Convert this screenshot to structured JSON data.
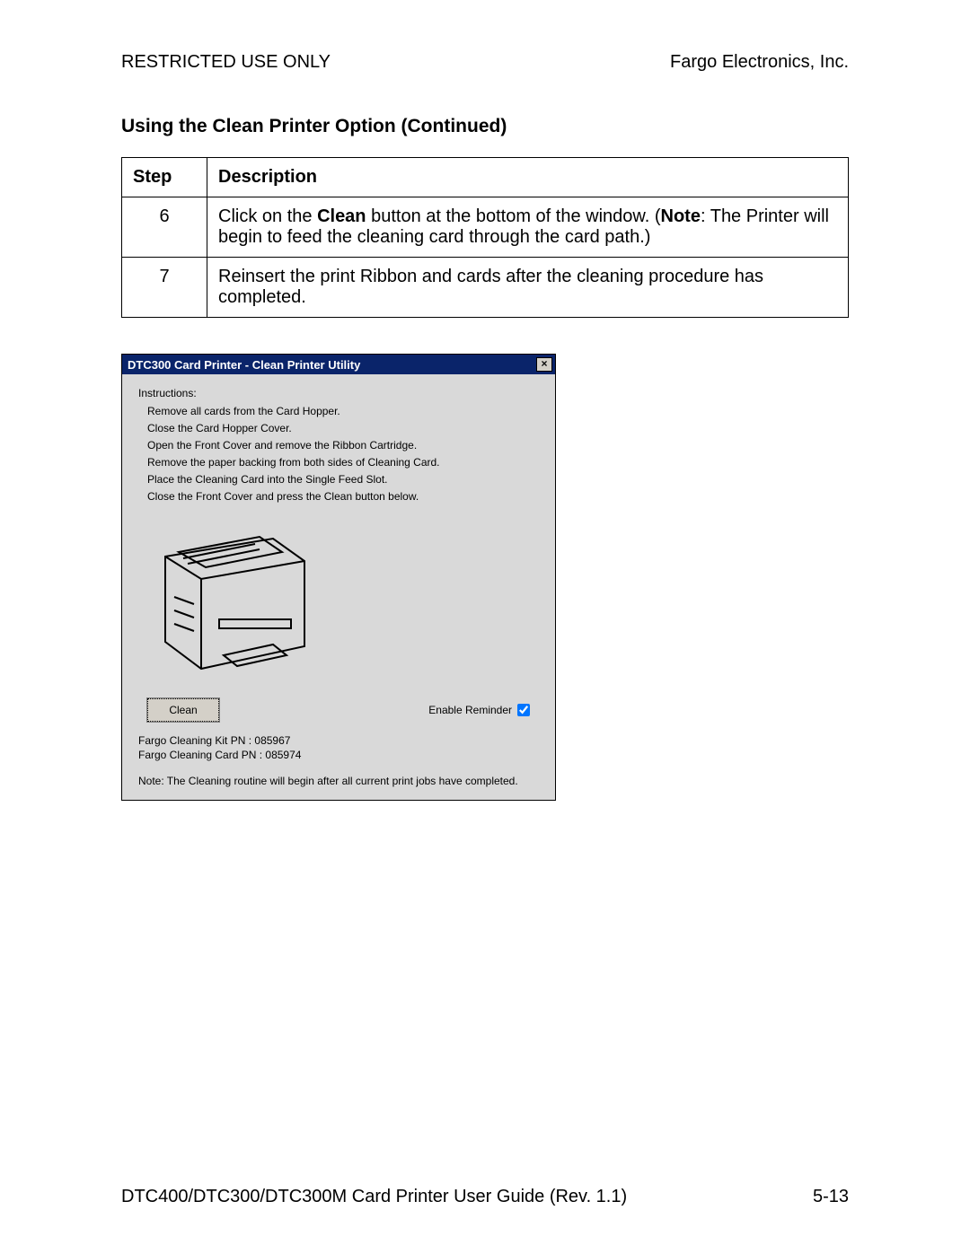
{
  "header": {
    "left": "RESTRICTED USE ONLY",
    "right": "Fargo Electronics, Inc."
  },
  "section_title": "Using the Clean Printer Option (Continued)",
  "table": {
    "headers": {
      "step": "Step",
      "desc": "Description"
    },
    "rows": [
      {
        "step": "6",
        "parts": [
          {
            "t": "Click on the "
          },
          {
            "t": "Clean",
            "b": true
          },
          {
            "t": " button at the bottom of the window. ("
          },
          {
            "t": "Note",
            "b": true
          },
          {
            "t": ": The Printer will begin to feed the cleaning card through the card path.)"
          }
        ]
      },
      {
        "step": "7",
        "parts": [
          {
            "t": "Reinsert the print Ribbon and cards after the cleaning procedure has completed."
          }
        ]
      }
    ]
  },
  "dialog": {
    "title": "DTC300 Card Printer - Clean Printer Utility",
    "close": "×",
    "instructions_label": "Instructions:",
    "instructions": [
      "Remove all cards from the Card Hopper.",
      "Close the Card Hopper Cover.",
      "Open the Front Cover and remove the Ribbon Cartridge.",
      "Remove the paper backing from both sides of Cleaning Card.",
      "Place the Cleaning Card into the Single Feed Slot.",
      "Close the Front Cover and press the Clean button below."
    ],
    "clean_button": "Clean",
    "reminder_label": "Enable Reminder",
    "reminder_checked": true,
    "kit_line": "Fargo Cleaning Kit PN : 085967",
    "card_line": "Fargo Cleaning Card PN : 085974",
    "note": "Note: The Cleaning routine will begin after all current print jobs have completed."
  },
  "footer": {
    "left": "DTC400/DTC300/DTC300M Card Printer User Guide (Rev. 1.1)",
    "right": "5-13"
  }
}
